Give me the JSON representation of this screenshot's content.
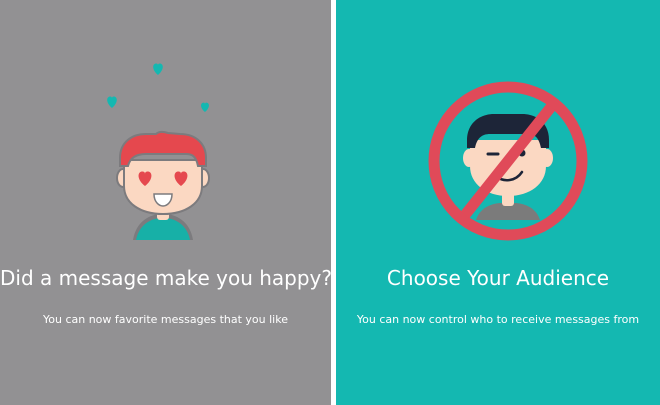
{
  "colors": {
    "left_bg": "#929193",
    "right_bg": "#14b8b1",
    "divider": "#ffffff",
    "text": "#ffffff",
    "heart": "#14b8b1",
    "hair_red": "#e5484e",
    "skin": "#fbd8c2",
    "shirt_teal": "#17b0a7",
    "hair_dark": "#1d2538",
    "shirt_gray": "#7b7b7b",
    "ban_red": "#e04a59"
  },
  "screens": [
    {
      "heading": "Did a message make you happy?",
      "subtext": "You can now favorite messages that you like",
      "illustration": "in-love-avatar-with-hearts-icon"
    },
    {
      "heading": "Choose Your Audience",
      "subtext": "You can now control who to receive messages from",
      "illustration": "avatar-prohibited-icon"
    }
  ]
}
